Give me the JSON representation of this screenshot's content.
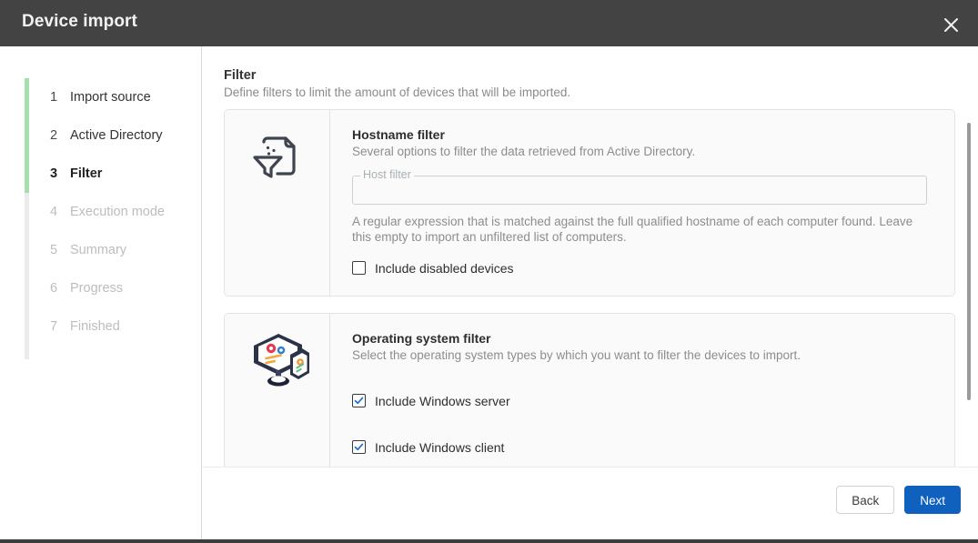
{
  "window": {
    "title": "Device import",
    "close_icon": "close-icon"
  },
  "sidebar": {
    "steps": [
      {
        "num": "1",
        "label": "Import source",
        "state": "done"
      },
      {
        "num": "2",
        "label": "Active Directory",
        "state": "done"
      },
      {
        "num": "3",
        "label": "Filter",
        "state": "current"
      },
      {
        "num": "4",
        "label": "Execution mode",
        "state": "disabled"
      },
      {
        "num": "5",
        "label": "Summary",
        "state": "disabled"
      },
      {
        "num": "6",
        "label": "Progress",
        "state": "disabled"
      },
      {
        "num": "7",
        "label": "Finished",
        "state": "disabled"
      }
    ],
    "rail_color": "#ebebeb",
    "rail_fill_color": "#a5dfae"
  },
  "content": {
    "title": "Filter",
    "subtitle": "Define filters to limit the amount of devices that will be imported.",
    "cards": [
      {
        "icon": "document-filter-icon",
        "title": "Hostname filter",
        "subtitle": "Several options to filter the data retrieved from Active Directory.",
        "field": {
          "label": "Host filter",
          "value": "",
          "placeholder": ""
        },
        "help": "A regular expression that is matched against the full qualified hostname of each computer found. Leave this empty to import an unfiltered list of computers.",
        "checkboxes": [
          {
            "label": "Include disabled devices",
            "checked": false
          }
        ]
      },
      {
        "icon": "monitor-gears-icon",
        "title": "Operating system filter",
        "subtitle": "Select the operating system types by which you want to filter the devices to import.",
        "checkboxes": [
          {
            "label": "Include Windows server",
            "checked": true
          },
          {
            "label": "Include Windows client",
            "checked": true
          }
        ]
      }
    ]
  },
  "footer": {
    "back_label": "Back",
    "next_label": "Next",
    "next_color": "#1061bd"
  },
  "scrollbar": {
    "thumb_color": "#9a9a9a"
  }
}
